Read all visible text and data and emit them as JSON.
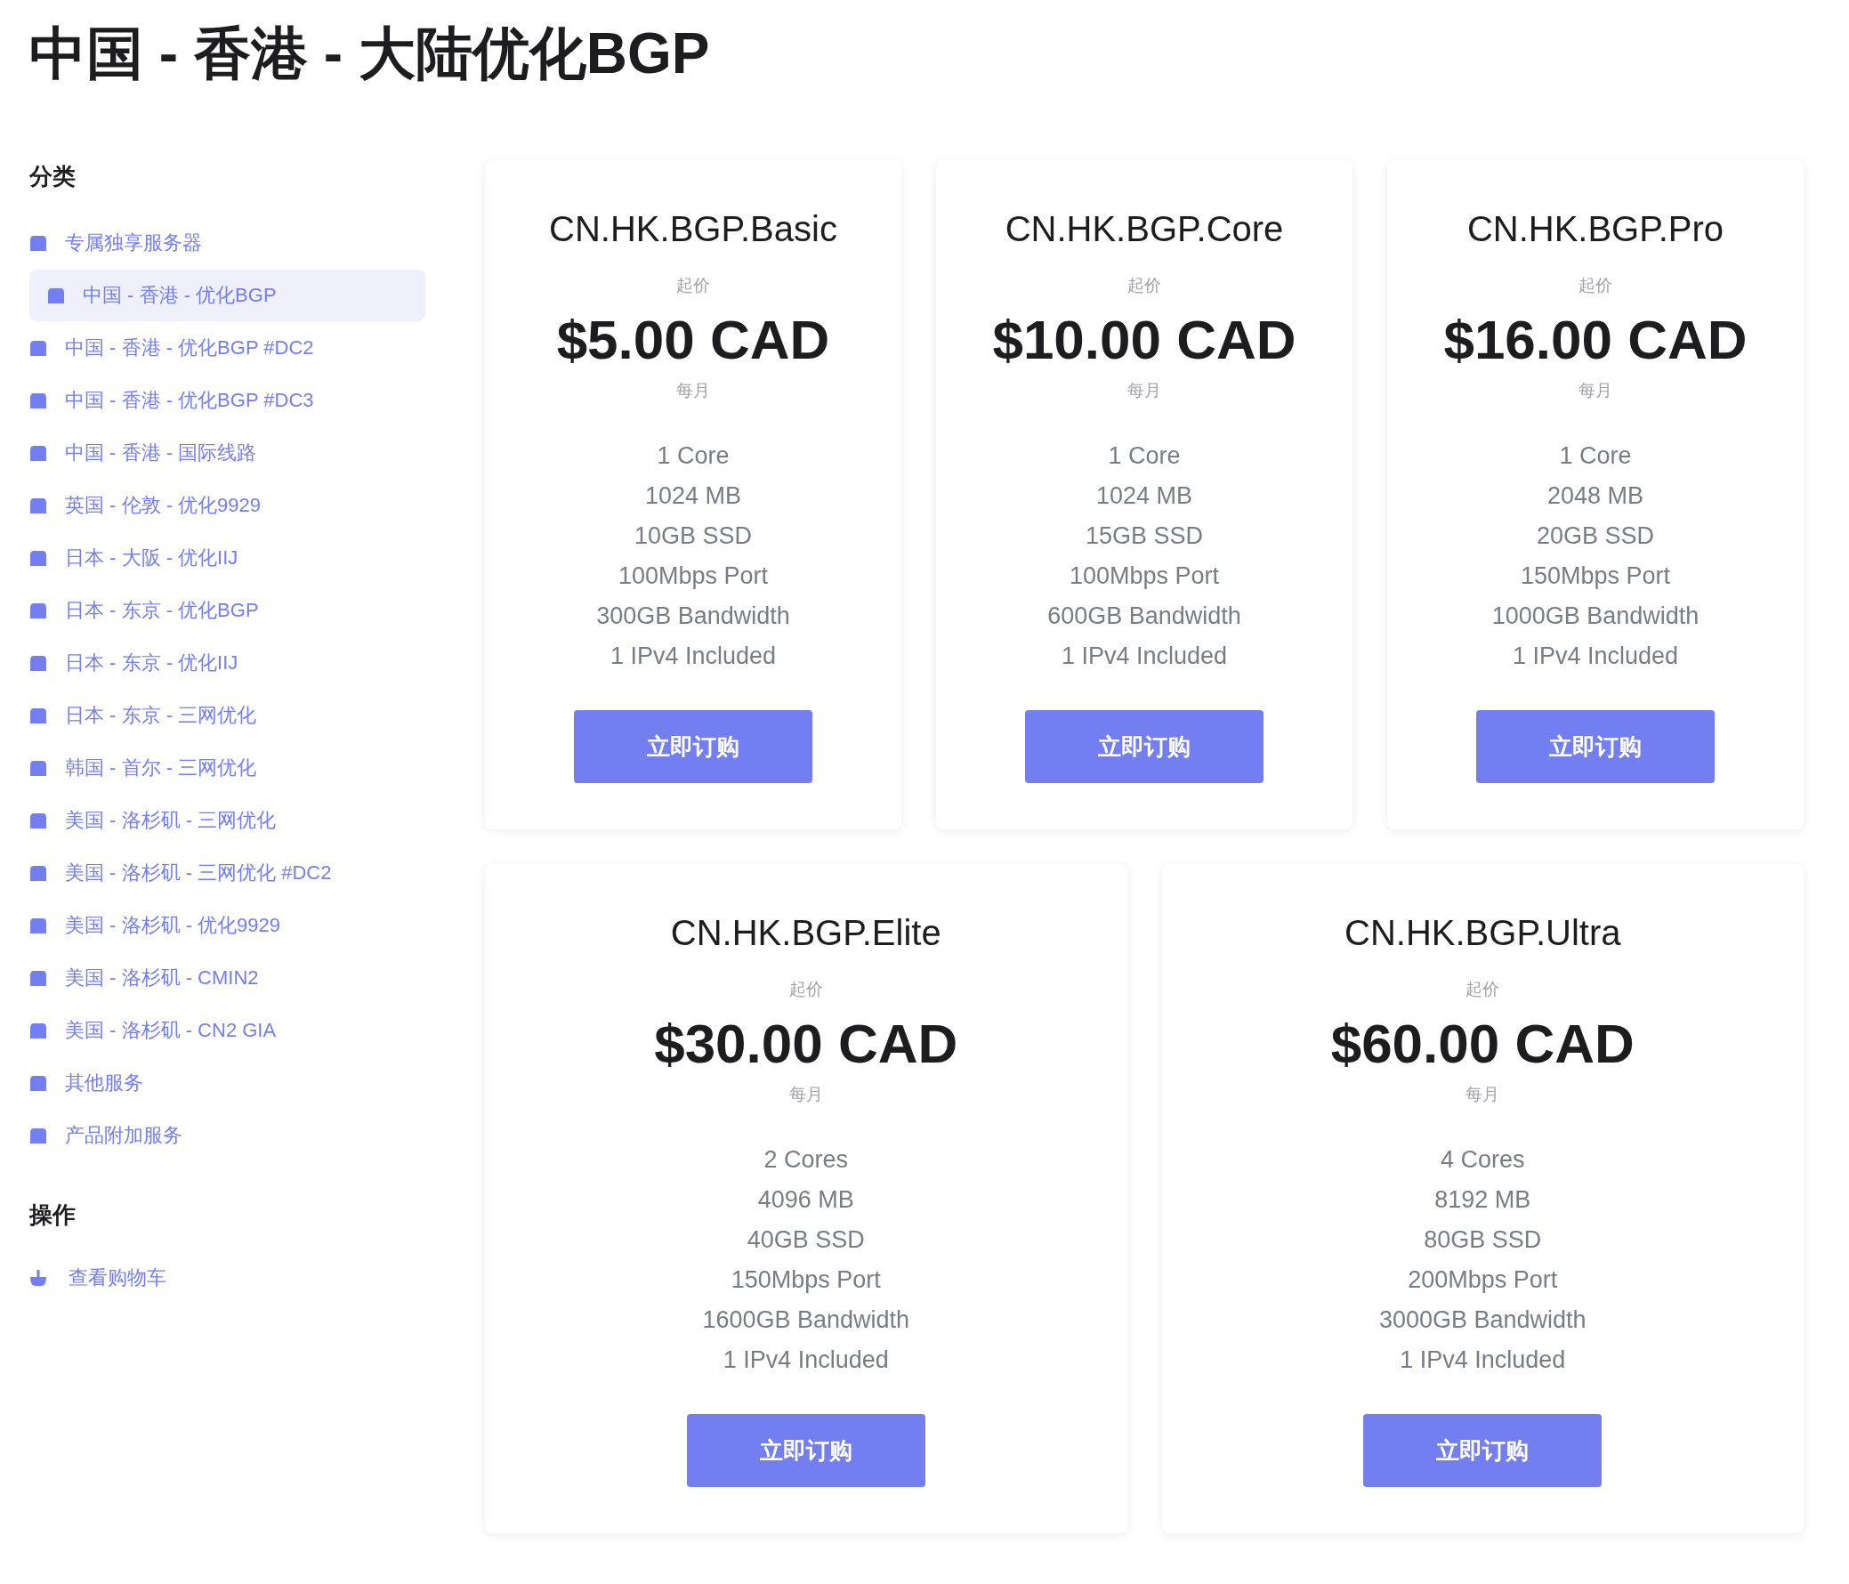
{
  "page_title": "中国 - 香港 - 大陆优化BGP",
  "sidebar": {
    "categories_heading": "分类",
    "categories": [
      {
        "label": "专属独享服务器",
        "selected": false
      },
      {
        "label": "中国 - 香港 - 优化BGP",
        "selected": true
      },
      {
        "label": "中国 - 香港 - 优化BGP #DC2",
        "selected": false
      },
      {
        "label": "中国 - 香港 - 优化BGP #DC3",
        "selected": false
      },
      {
        "label": "中国 - 香港 - 国际线路",
        "selected": false
      },
      {
        "label": "英国 - 伦敦 - 优化9929",
        "selected": false
      },
      {
        "label": "日本 - 大阪 - 优化IIJ",
        "selected": false
      },
      {
        "label": "日本 - 东京 - 优化BGP",
        "selected": false
      },
      {
        "label": "日本 - 东京 - 优化IIJ",
        "selected": false
      },
      {
        "label": "日本 - 东京 - 三网优化",
        "selected": false
      },
      {
        "label": "韩国 - 首尔 - 三网优化",
        "selected": false
      },
      {
        "label": "美国 - 洛杉矶 - 三网优化",
        "selected": false
      },
      {
        "label": "美国 - 洛杉矶 - 三网优化 #DC2",
        "selected": false
      },
      {
        "label": "美国 - 洛杉矶 - 优化9929",
        "selected": false
      },
      {
        "label": "美国 - 洛杉矶 - CMIN2",
        "selected": false
      },
      {
        "label": "美国 - 洛杉矶 - CN2 GIA",
        "selected": false
      },
      {
        "label": "其他服务",
        "selected": false
      },
      {
        "label": "产品附加服务",
        "selected": false
      }
    ],
    "actions_heading": "操作",
    "actions": [
      {
        "label": "查看购物车"
      }
    ]
  },
  "product_rows": [
    [
      {
        "name": "CN.HK.BGP.Basic",
        "price_prefix": "起价",
        "price": "$5.00 CAD",
        "cycle": "每月",
        "features": [
          "1 Core",
          "1024 MB",
          "10GB SSD",
          "100Mbps Port",
          "300GB Bandwidth",
          "1 IPv4 Included"
        ],
        "button": "立即订购"
      },
      {
        "name": "CN.HK.BGP.Core",
        "price_prefix": "起价",
        "price": "$10.00 CAD",
        "cycle": "每月",
        "features": [
          "1 Core",
          "1024 MB",
          "15GB SSD",
          "100Mbps Port",
          "600GB Bandwidth",
          "1 IPv4 Included"
        ],
        "button": "立即订购"
      },
      {
        "name": "CN.HK.BGP.Pro",
        "price_prefix": "起价",
        "price": "$16.00 CAD",
        "cycle": "每月",
        "features": [
          "1 Core",
          "2048 MB",
          "20GB SSD",
          "150Mbps Port",
          "1000GB Bandwidth",
          "1 IPv4 Included"
        ],
        "button": "立即订购"
      }
    ],
    [
      {
        "name": "CN.HK.BGP.Elite",
        "price_prefix": "起价",
        "price": "$30.00 CAD",
        "cycle": "每月",
        "features": [
          "2 Cores",
          "4096 MB",
          "40GB SSD",
          "150Mbps Port",
          "1600GB Bandwidth",
          "1 IPv4 Included"
        ],
        "button": "立即订购"
      },
      {
        "name": "CN.HK.BGP.Ultra",
        "price_prefix": "起价",
        "price": "$60.00 CAD",
        "cycle": "每月",
        "features": [
          "4 Cores",
          "8192 MB",
          "80GB SSD",
          "200Mbps Port",
          "3000GB Bandwidth",
          "1 IPv4 Included"
        ],
        "button": "立即订购"
      }
    ]
  ]
}
